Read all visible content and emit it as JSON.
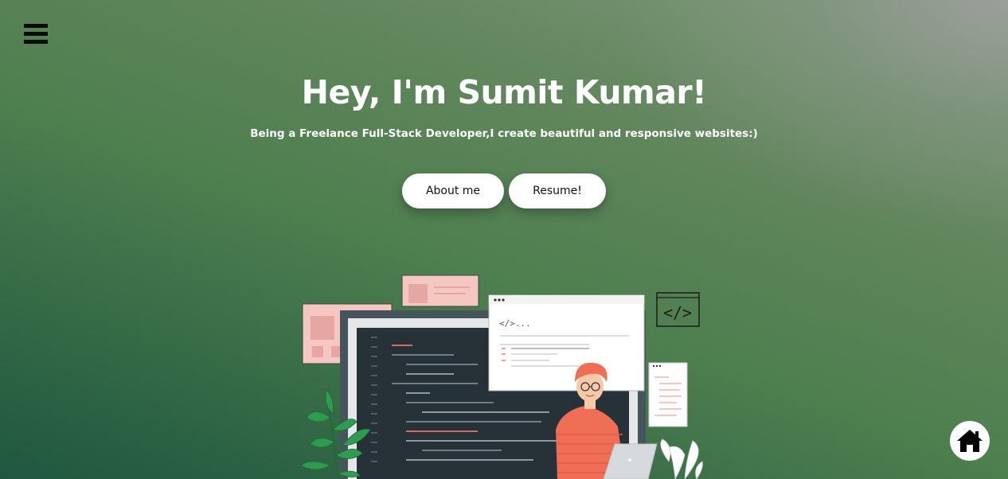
{
  "hero": {
    "title": "Hey, I'm Sumit Kumar!",
    "subtitle": "Being a Freelance Full-Stack Developer,I create beautiful and responsive websites:)"
  },
  "buttons": {
    "about_label": "About me",
    "resume_label": "Resume!"
  },
  "icons": {
    "menu": "hamburger-menu-icon",
    "home": "home-icon"
  },
  "illustration": {
    "code_tag_text": "</>...",
    "code_badge_text": "</>"
  },
  "colors": {
    "text": "#ffffff",
    "button_bg": "#ffffff",
    "accent_pink": "#f4c7c3",
    "shirt": "#ef6f56",
    "dark_screen": "#263138"
  }
}
